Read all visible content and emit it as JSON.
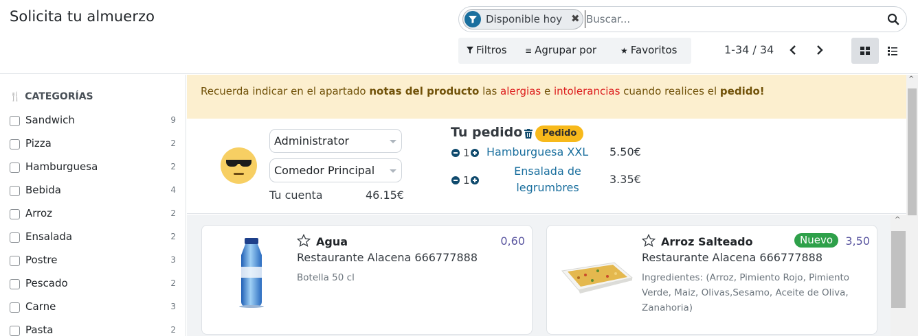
{
  "page": {
    "title": "Solicita tu almuerzo"
  },
  "search": {
    "facet_label": "Disponible hoy",
    "placeholder": "Buscar..."
  },
  "toolbar": {
    "filters": "Filtros",
    "group_by": "Agrupar por",
    "favorites": "Favoritos",
    "pager": "1-34 / 34"
  },
  "sidebar": {
    "heading": "CATEGORÍAS",
    "categories": [
      {
        "label": "Sandwich",
        "count": "9"
      },
      {
        "label": "Pizza",
        "count": "2"
      },
      {
        "label": "Hamburguesa",
        "count": "2"
      },
      {
        "label": "Bebida",
        "count": "4"
      },
      {
        "label": "Arroz",
        "count": "2"
      },
      {
        "label": "Ensalada",
        "count": "2"
      },
      {
        "label": "Postre",
        "count": "3"
      },
      {
        "label": "Pescado",
        "count": "2"
      },
      {
        "label": "Carne",
        "count": "3"
      },
      {
        "label": "Pasta",
        "count": "2"
      }
    ]
  },
  "alert": {
    "p1": "Recuerda indicar en el apartado ",
    "b1": "notas del producto",
    "p2": " las ",
    "r1": "alergias",
    "p3": " e ",
    "r2": "intolerancias",
    "p4": " cuando realices el ",
    "b2": "pedido!"
  },
  "order": {
    "user": "Administrator",
    "location": "Comedor Principal",
    "account_label": "Tu cuenta",
    "account_value": "46.15€",
    "title": "Tu pedido",
    "status": "Pedido",
    "lines": [
      {
        "qty": "1",
        "name": "Hamburguesa XXL",
        "price": "5.50€"
      },
      {
        "qty": "1",
        "name": "Ensalada de legrumbres",
        "name_l1": "Ensalada de",
        "name_l2": "legrumbres",
        "price": "3.35€"
      }
    ]
  },
  "products": [
    {
      "name": "Agua",
      "price": "0,60",
      "vendor": "Restaurante Alacena 666777888",
      "description": "Botella 50 cl"
    },
    {
      "name": "Arroz Salteado",
      "badge": "Nuevo",
      "price": "3,50",
      "vendor": "Restaurante Alacena 666777888",
      "description": "Ingredientes: (Arroz, Pimiento Rojo, Pimiento Verde, Maiz, Olivas,Sesamo, Aceite de Oliva, Zanahoria)"
    }
  ],
  "colors": {
    "accent": "#1a6f9e",
    "alert_bg": "#fcefcf",
    "status_badge": "#f7b91b",
    "new_badge": "#2ea04a",
    "price": "#5a56a0"
  },
  "icons": [
    "filter-icon",
    "remove-facet-icon",
    "search-icon",
    "funnel-icon",
    "list-lines-icon",
    "star-icon",
    "chevron-left-icon",
    "chevron-right-icon",
    "kanban-view-icon",
    "list-view-icon",
    "cutlery-icon",
    "sunglasses-emoji-icon",
    "trash-icon",
    "minus-icon",
    "plus-icon"
  ]
}
